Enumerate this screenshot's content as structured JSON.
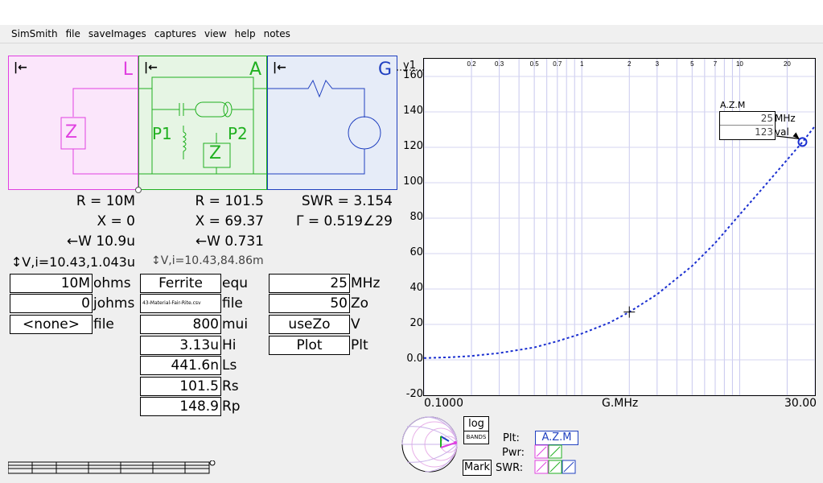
{
  "menu": [
    "SimSmith",
    "file",
    "saveImages",
    "captures",
    "view",
    "help",
    "notes"
  ],
  "blocks": {
    "L": {
      "letter": "L",
      "z_label": "Z"
    },
    "A": {
      "letter": "A",
      "p1": "P1",
      "p2": "P2",
      "z_label": "Z"
    },
    "G": {
      "letter": "G"
    },
    "arrow": "|←"
  },
  "readouts": {
    "L": {
      "r": "R = 10M",
      "x": "X = 0",
      "w": "←W 10.9u",
      "vi": "↕V,i=10.43,1.043u"
    },
    "A": {
      "r": "R = 101.5",
      "x": "X = 69.37",
      "w": "←W 0.731",
      "vi": "↕V,i=10.43,84.86m"
    },
    "G": {
      "swr": "SWR = 3.154",
      "gamma": "Γ = 0.519∠29"
    }
  },
  "fields": {
    "L": [
      {
        "value": "10M",
        "unit": "ohms"
      },
      {
        "value": "0",
        "unit": "johms"
      },
      {
        "value": "<none>",
        "unit": "file"
      }
    ],
    "A": [
      {
        "value": "Ferrite",
        "unit": "equ"
      },
      {
        "value": "43-Material-Fair-Rite.csv",
        "unit": "file"
      },
      {
        "value": "800",
        "unit": "mui"
      },
      {
        "value": "3.13u",
        "unit": "Hi"
      },
      {
        "value": "441.6n",
        "unit": "Ls"
      },
      {
        "value": "101.5",
        "unit": "Rs"
      },
      {
        "value": "148.9",
        "unit": "Rp"
      }
    ],
    "G": [
      {
        "value": "25",
        "unit": "MHz"
      },
      {
        "value": "50",
        "unit": "Zo"
      },
      {
        "value": "useZo",
        "unit": "V"
      },
      {
        "value": "Plot",
        "unit": "Plt"
      }
    ]
  },
  "chart_data": {
    "type": "line",
    "title": "",
    "ylabel": "y1",
    "xlabel": "G.MHz",
    "x_scale": "log",
    "xlim": [
      0.1,
      30.0
    ],
    "ylim": [
      -20,
      170
    ],
    "x_tick_labels_bottom": [
      "0.1000",
      "G.MHz",
      "30.00"
    ],
    "x_tick_labels_top": [
      "0.2",
      "0.3",
      "0.5",
      "0.7",
      "1",
      "2",
      "3",
      "5",
      "7",
      "10",
      "20"
    ],
    "y_tick_labels": [
      "160",
      "140",
      "120",
      "100",
      "80",
      "60",
      "40",
      "20",
      "0.0",
      "-20"
    ],
    "grid": true,
    "series": [
      {
        "x": [
          0.1,
          0.15,
          0.2,
          0.3,
          0.5,
          0.7,
          1,
          1.5,
          2,
          3,
          5,
          7,
          10,
          15,
          20,
          25,
          30
        ],
        "y": [
          1,
          1.5,
          2.2,
          3.8,
          7,
          10.5,
          14.8,
          21,
          27,
          37,
          53,
          66,
          82,
          100,
          113,
          123,
          132
        ],
        "color": "#1a2fd0"
      }
    ],
    "marker": {
      "x": 2,
      "y": 27
    },
    "annotation": {
      "title": "A.Z.M",
      "value1": "25",
      "unit1": "MHz",
      "value2": "123",
      "unit2": "val",
      "x": 25,
      "y": 123
    }
  },
  "bottom": {
    "log_btn": "log",
    "bands_btn": "BANDS",
    "mark_btn": "Mark",
    "plt_label": "Plt:",
    "plt_value": "A.Z.M",
    "pwr_label": "Pwr:",
    "swr_label": "SWR:"
  },
  "colors": {
    "L": "#e040e0",
    "A": "#20b020",
    "G": "#2040c0",
    "curve": "#1a2fd0"
  }
}
